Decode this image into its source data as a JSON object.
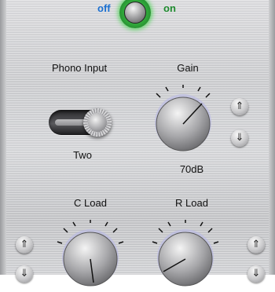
{
  "power": {
    "off_label": "off",
    "on_label": "on",
    "state": "on"
  },
  "phono_input": {
    "title": "Phono Input",
    "value": "Two"
  },
  "gain": {
    "title": "Gain",
    "value": "70dB",
    "up_glyph": "⇑",
    "down_glyph": "⇓"
  },
  "c_load": {
    "title": "C Load",
    "up_glyph": "⇑",
    "down_glyph": "⇓"
  },
  "r_load": {
    "title": "R Load",
    "up_glyph": "⇑",
    "down_glyph": "⇓"
  },
  "icons": {
    "power": "power-icon",
    "up": "up-double-arrow-icon",
    "down": "down-double-arrow-icon"
  },
  "colors": {
    "off": "#1a6fd0",
    "on": "#1e8b2e",
    "power_glow": "#3cd246"
  }
}
